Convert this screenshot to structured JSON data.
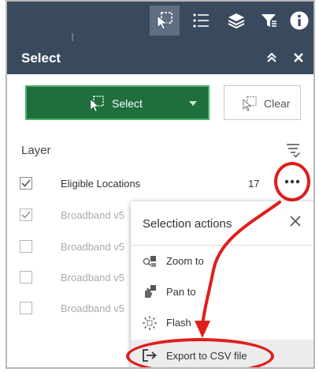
{
  "panel": {
    "title": "Select"
  },
  "select_button": {
    "label": "Select"
  },
  "clear_button": {
    "label": "Clear"
  },
  "layers": {
    "heading": "Layer",
    "items": [
      {
        "label": "Eligible Locations",
        "count": "17",
        "checked": true
      },
      {
        "label": "Broadband v5",
        "checked": true
      },
      {
        "label": "Broadband v5",
        "checked": false
      },
      {
        "label": "Broadband v5",
        "checked": false
      },
      {
        "label": "Broadband v5",
        "checked": false
      }
    ]
  },
  "menu": {
    "title": "Selection actions",
    "items": [
      {
        "label": "Zoom to",
        "icon": "zoom-to-icon"
      },
      {
        "label": "Pan to",
        "icon": "pan-to-icon"
      },
      {
        "label": "Flash",
        "icon": "flash-icon"
      },
      {
        "label": "Export to CSV file",
        "icon": "export-icon"
      }
    ]
  },
  "colors": {
    "header_bg": "#3a4a5e",
    "select_green": "#1f6e3c",
    "annotation_red": "#e01d1d"
  }
}
